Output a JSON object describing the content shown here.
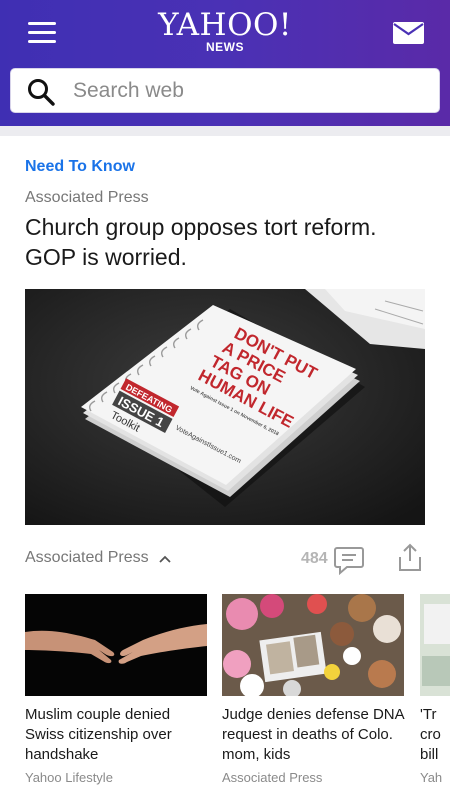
{
  "header": {
    "logo_text": "YAHOO!",
    "logo_sub": "NEWS",
    "menu_icon": "menu-icon",
    "mail_icon": "mail-icon",
    "gradient_colors": [
      "#3f2fb3",
      "#5a2aa8"
    ]
  },
  "search": {
    "placeholder": "Search web",
    "value": ""
  },
  "main_story": {
    "section_label": "Need To Know",
    "source": "Associated Press",
    "headline": "Church group opposes tort reform. GOP is worried.",
    "image_text": {
      "line1": "DON'T PUT",
      "line2": "A PRICE",
      "line3": "TAG ON",
      "line4": "HUMAN LIFE",
      "small": "Vote Against Issue 1 on November 6, 2018",
      "badge1": "DEFEATING",
      "badge2": "ISSUE 1",
      "badge3": "Toolkit",
      "url": "VoteAgainstIssue1.com"
    },
    "source_bottom": "Associated Press",
    "comment_count": "484"
  },
  "cards": [
    {
      "title": "Muslim couple denied Swiss citizenship over handshake",
      "source": "Yahoo Lifestyle"
    },
    {
      "title": "Judge denies defense DNA request in deaths of Colo. mom, kids",
      "source": "Associated Press"
    },
    {
      "title": "'Tr cro bill",
      "source": "Yah"
    }
  ],
  "colors": {
    "accent_blue": "#1a73e8",
    "text_dark": "#1a1a1a",
    "text_muted": "#777777",
    "book_red": "#c1272d"
  }
}
